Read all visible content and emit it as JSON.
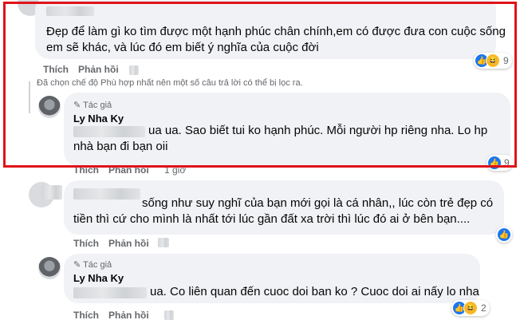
{
  "comment1": {
    "text_line1": "Đẹp để làm gì ko tìm được một hạnh phúc chân chính,em có được đưa con cuộc sống",
    "text_line2": "em sẽ khác, và lúc đó em biết ý nghĩa của cuộc đời",
    "like_label": "Thích",
    "reply_label": "Phản hồi",
    "reaction_count": "9"
  },
  "filter_note": "Đã chọn chế độ Phù hợp nhất nên một số câu trả lời có thể bị lọc ra.",
  "reply1": {
    "author_badge": "Tác giả",
    "author_name": "Ly Nha Ky",
    "text_line1": "ua ua. Sao biết tui ko hạnh phúc. Mỗi người hp riêng nha. Lo hp",
    "text_line2": "nhà bạn đi bạn oii",
    "like_label": "Thích",
    "reply_label": "Phản hồi",
    "time": "1 giờ",
    "reaction_count": "9"
  },
  "comment2": {
    "text_line1": "sống như suy nghĩ của bạn mới gọi là cá nhân,, lúc còn trẻ đẹp có",
    "text_line2": "tiền thì cứ cho mình là nhất tới lúc gần đất xa trời thì lúc đó ai ở bên bạn....",
    "like_label": "Thích",
    "reply_label": "Phản hồi"
  },
  "reply2": {
    "author_badge": "Tác giả",
    "author_name": "Ly Nha Ky",
    "text_line1": "ua. Co liên quan đến cuoc doi ban ko ? Cuoc doi ai nấy lo nha",
    "like_label": "Thích",
    "reply_label": "Phản hồi",
    "reaction_count": "2"
  },
  "icons": [
    "like-icon",
    "haha-icon",
    "pen-icon"
  ],
  "colors": {
    "highlight_box": "#e0131a",
    "bubble": "#f0f2f5",
    "like": "#1877f2"
  }
}
